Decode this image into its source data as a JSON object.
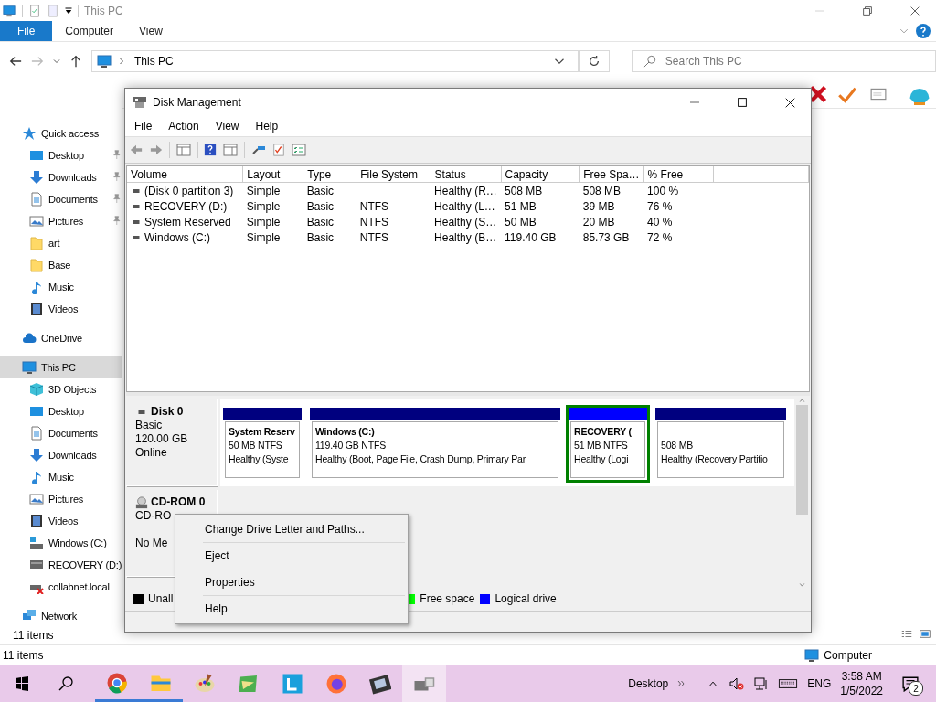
{
  "explorer": {
    "title": "This PC",
    "ribbon_tabs": [
      {
        "label": "File",
        "selected": true
      },
      {
        "label": "Computer",
        "selected": false
      },
      {
        "label": "View",
        "selected": false
      }
    ],
    "address": "This PC",
    "search": {
      "placeholder": "Search This PC"
    },
    "nav": [
      {
        "label": "Quick access",
        "selected": false,
        "children": [
          {
            "label": "Desktop",
            "pinned": true,
            "selected": false
          },
          {
            "label": "Downloads",
            "pinned": true,
            "selected": false
          },
          {
            "label": "Documents",
            "pinned": true,
            "selected": false
          },
          {
            "label": "Pictures",
            "pinned": true,
            "selected": false
          },
          {
            "label": "art",
            "pinned": false,
            "selected": false
          },
          {
            "label": "Base",
            "pinned": false,
            "selected": false
          },
          {
            "label": "Music",
            "pinned": false,
            "selected": false
          },
          {
            "label": "Videos",
            "pinned": false,
            "selected": false
          }
        ]
      },
      {
        "label": "OneDrive",
        "selected": false
      },
      {
        "label": "This PC",
        "selected": true,
        "children": [
          {
            "label": "3D Objects",
            "pinned": false,
            "selected": false
          },
          {
            "label": "Desktop",
            "pinned": false,
            "selected": false
          },
          {
            "label": "Documents",
            "pinned": false,
            "selected": false
          },
          {
            "label": "Downloads",
            "pinned": false,
            "selected": false
          },
          {
            "label": "Music",
            "pinned": false,
            "selected": false
          },
          {
            "label": "Pictures",
            "pinned": false,
            "selected": false
          },
          {
            "label": "Videos",
            "pinned": false,
            "selected": false
          },
          {
            "label": "Windows (C:)",
            "pinned": false,
            "selected": false
          },
          {
            "label": "RECOVERY (D:)",
            "pinned": false,
            "selected": false
          },
          {
            "label": "collabnet.local",
            "pinned": false,
            "selected": false
          }
        ]
      },
      {
        "label": "Network",
        "selected": false
      }
    ],
    "status": "11 items",
    "status_back": "11 items",
    "status_location": "Computer"
  },
  "disk_management": {
    "title": "Disk Management",
    "menu": [
      "File",
      "Action",
      "View",
      "Help"
    ],
    "volumes": {
      "columns": [
        "Volume",
        "Layout",
        "Type",
        "File System",
        "Status",
        "Capacity",
        "Free Spa…",
        "% Free"
      ],
      "rows": [
        [
          "(Disk 0 partition 3)",
          "Simple",
          "Basic",
          "",
          "Healthy (R…",
          "508 MB",
          "508 MB",
          "100 %"
        ],
        [
          "RECOVERY (D:)",
          "Simple",
          "Basic",
          "NTFS",
          "Healthy (L…",
          "51 MB",
          "39 MB",
          "76 %"
        ],
        [
          "System Reserved",
          "Simple",
          "Basic",
          "NTFS",
          "Healthy (S…",
          "50 MB",
          "20 MB",
          "40 %"
        ],
        [
          "Windows (C:)",
          "Simple",
          "Basic",
          "NTFS",
          "Healthy (B…",
          "119.40 GB",
          "85.73 GB",
          "72 %"
        ]
      ]
    },
    "disks": [
      {
        "name": "Disk 0",
        "type": "Basic",
        "size": "120.00 GB",
        "state": "Online",
        "partitions": [
          {
            "name": "System Reserv",
            "size": "50 MB NTFS",
            "status": "Healthy (Syste",
            "color": "#00007f",
            "selected": false
          },
          {
            "name": "Windows  (C:)",
            "size": "119.40 GB NTFS",
            "status": "Healthy (Boot, Page File, Crash Dump, Primary Par",
            "color": "#00007f",
            "selected": false
          },
          {
            "name": "RECOVERY  (",
            "size": "51 MB NTFS",
            "status": "Healthy (Logi",
            "color": "#0000ff",
            "selected": true
          },
          {
            "size": "508 MB",
            "status": "Healthy (Recovery Partitio",
            "color": "#00007f",
            "selected": false
          }
        ]
      },
      {
        "name": "CD-ROM 0",
        "type": "CD-RO",
        "state": "No Me"
      }
    ],
    "legend": [
      {
        "label": "Unall",
        "color": "#000000"
      },
      {
        "label": "Free space",
        "color": "#00ff00"
      },
      {
        "label": "Logical drive",
        "color": "#0000ff"
      }
    ],
    "context_menu": [
      "Change Drive Letter and Paths...",
      "Eject",
      "Properties",
      "Help"
    ]
  },
  "taskbar": {
    "apps": [
      {
        "running": true,
        "selected": false
      },
      {
        "running": true,
        "selected": false
      },
      {
        "running": false,
        "selected": false
      },
      {
        "running": false,
        "selected": false
      },
      {
        "running": false,
        "selected": false
      },
      {
        "running": false,
        "selected": false
      },
      {
        "running": false,
        "selected": false
      },
      {
        "running": false,
        "selected": true
      }
    ],
    "toolbar_label": "Desktop",
    "language": "ENG",
    "time": "3:58 AM",
    "date": "1/5/2022",
    "notifications": "2"
  }
}
